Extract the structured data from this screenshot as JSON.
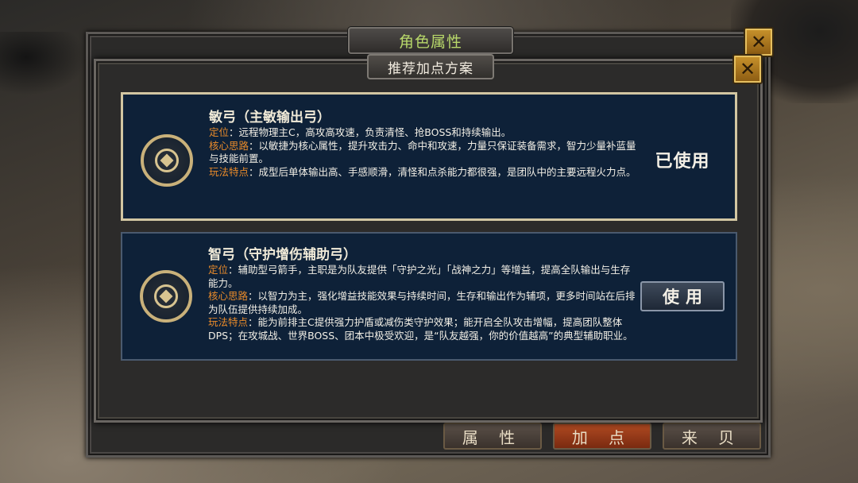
{
  "outer_panel": {
    "title": "角色属性",
    "bottom_buttons": [
      "属 性",
      "加 点",
      "来 贝"
    ]
  },
  "inner_panel": {
    "title": "推荐加点方案"
  },
  "cards": [
    {
      "title": "敏弓（主敏输出弓）",
      "positioning_label": "定位",
      "positioning_text": "：远程物理主C，高攻高攻速，负责清怪、抢BOSS和持续输出。",
      "core_label": "核心思路",
      "core_text": "：以敏捷为核心属性，提升攻击力、命中和攻速，力量只保证装备需求，智力少量补蓝量与技能前置。",
      "feature_label": "玩法特点",
      "feature_text": "：成型后单体输出高、手感顺滑，清怪和点杀能力都很强，是团队中的主要远程火力点。",
      "status": "已使用"
    },
    {
      "title": "智弓（守护增伤辅助弓）",
      "positioning_label": "定位",
      "positioning_text": "：辅助型弓箭手，主职是为队友提供「守护之光」「战神之力」等增益，提高全队输出与生存能力。",
      "core_label": "核心思路",
      "core_text": "：以智力为主，强化增益技能效果与持续时间，生存和输出作为辅项，更多时间站在后排为队伍提供持续加成。",
      "feature_label": "玩法特点",
      "feature_text": "：能为前排主C提供强力护盾或减伤类守护效果；能开启全队攻击增幅，提高团队整体DPS；在攻城战、世界BOSS、团本中极受欢迎，是“队友越强，你的价值越高”的典型辅助职业。",
      "button": "使用"
    }
  ],
  "colors": {
    "card_bg": "#0e2138",
    "label_orange": "#e88a2a",
    "outer_title_green": "#b8d86a",
    "close_gold": "#c9932c"
  },
  "icons": {
    "close": "close-icon",
    "emblem": "bow-class-emblem-icon"
  }
}
